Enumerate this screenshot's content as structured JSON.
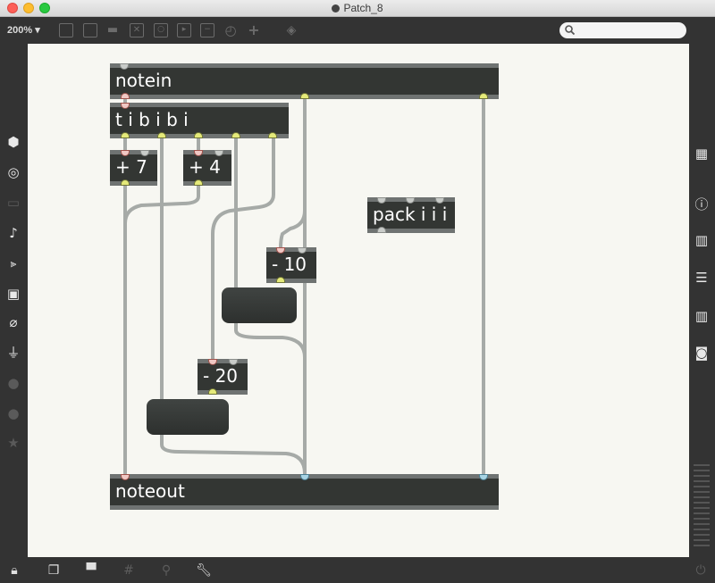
{
  "window": {
    "title": "Patch_8"
  },
  "toolbar": {
    "zoom_label": "200% ▾",
    "search_placeholder": ""
  },
  "objects": {
    "notein": "notein",
    "trigger": "t i b i b i",
    "add7": "+ 7",
    "add4": "+ 4",
    "pack": "pack i i i",
    "sub10": "- 10",
    "sub20": "- 20",
    "noteout": "noteout"
  },
  "colors": {
    "canvas": "#f7f7f2",
    "object_fill": "#333633",
    "object_border": "#6f7372",
    "cable": "#a6aaa7",
    "inlet_pink": "#f0c8c4",
    "outlet_yellow": "#e5ea7a",
    "inlet_blue": "#a8d4e4"
  },
  "icons": {
    "left_sidebar": [
      "cube-icon",
      "target-icon",
      "video-icon",
      "music-note-icon",
      "play-list-icon",
      "image-icon",
      "paperclip-icon",
      "plug-icon",
      "vimeo-icon",
      "clock-icon",
      "star-icon"
    ],
    "right_sidebar": [
      "grid-icon",
      "info-icon",
      "book-icon",
      "list-icon",
      "reference-icon",
      "camera-icon"
    ],
    "bottom_bar": [
      "lock-icon",
      "windows-icon",
      "presentation-icon",
      "grid-icon",
      "pin-icon",
      "wrench-icon",
      "power-icon"
    ]
  }
}
